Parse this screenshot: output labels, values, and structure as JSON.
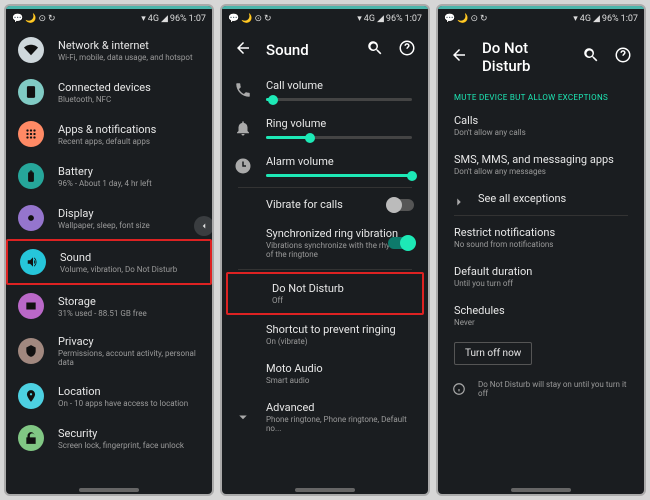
{
  "statusbar": {
    "battery": "96%",
    "time": "1:07",
    "netlabel": "4G"
  },
  "panel1": {
    "items": [
      {
        "label": "Network & internet",
        "sub": "Wi-Fi, mobile, data usage, and hotspot",
        "color": "#cfd8dc"
      },
      {
        "label": "Connected devices",
        "sub": "Bluetooth, NFC",
        "color": "#80cbc4"
      },
      {
        "label": "Apps & notifications",
        "sub": "Recent apps, default apps",
        "color": "#ff8a65"
      },
      {
        "label": "Battery",
        "sub": "96% - About 1 day, 4 hr left",
        "color": "#26a69a"
      },
      {
        "label": "Display",
        "sub": "Wallpaper, sleep, font size",
        "color": "#9575cd"
      },
      {
        "label": "Sound",
        "sub": "Volume, vibration, Do Not Disturb",
        "color": "#26c6da"
      },
      {
        "label": "Storage",
        "sub": "31% used - 88.51 GB free",
        "color": "#ba68c8"
      },
      {
        "label": "Privacy",
        "sub": "Permissions, account activity, personal data",
        "color": "#a1887f"
      },
      {
        "label": "Location",
        "sub": "On - 10 apps have access to location",
        "color": "#4dd0e1"
      },
      {
        "label": "Security",
        "sub": "Screen lock, fingerprint, face unlock",
        "color": "#81c784"
      }
    ],
    "highlight_index": 5
  },
  "panel2": {
    "title": "Sound",
    "sliders": [
      {
        "label": "Call volume",
        "value": 5
      },
      {
        "label": "Ring volume",
        "value": 30
      },
      {
        "label": "Alarm volume",
        "value": 100
      }
    ],
    "rows": {
      "vibrate": {
        "label": "Vibrate for calls",
        "on": false
      },
      "sync": {
        "label": "Synchronized ring vibration",
        "sub": "Vibrations synchronize with the rhythm of the ringtone",
        "on": true
      },
      "dnd": {
        "label": "Do Not Disturb",
        "sub": "Off"
      },
      "shortcut": {
        "label": "Shortcut to prevent ringing",
        "sub": "On (vibrate)"
      },
      "moto": {
        "label": "Moto Audio",
        "sub": "Smart audio"
      },
      "advanced": {
        "label": "Advanced",
        "sub": "Phone ringtone, Phone ringtone, Default no..."
      }
    }
  },
  "panel3": {
    "title": "Do Not Disturb",
    "section": "MUTE DEVICE BUT ALLOW EXCEPTIONS",
    "calls": {
      "label": "Calls",
      "sub": "Don't allow any calls"
    },
    "sms": {
      "label": "SMS, MMS, and messaging apps",
      "sub": "Don't allow any messages"
    },
    "seeall": {
      "label": "See all exceptions"
    },
    "restrict": {
      "label": "Restrict notifications",
      "sub": "No sound from notifications"
    },
    "duration": {
      "label": "Default duration",
      "sub": "Until you turn off"
    },
    "schedules": {
      "label": "Schedules",
      "sub": "Never"
    },
    "turnoff": {
      "label": "Turn off now"
    },
    "info": {
      "text": "Do Not Disturb will stay on until you turn it off"
    }
  }
}
